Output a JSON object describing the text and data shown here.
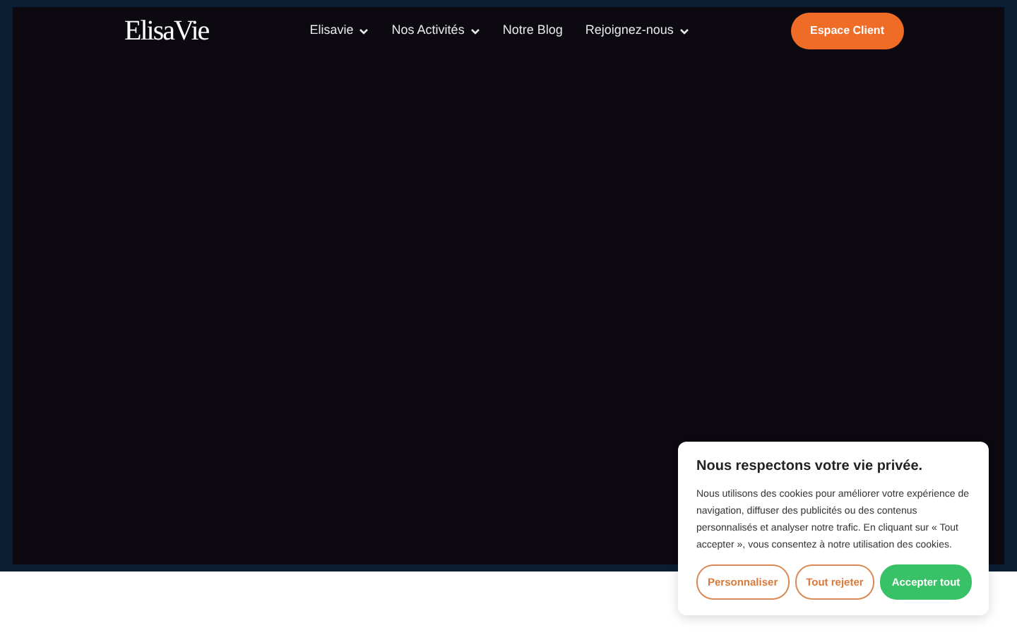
{
  "logo": "ElisaVie",
  "nav": [
    {
      "label": "Elisavie",
      "dropdown": true
    },
    {
      "label": "Nos Activités",
      "dropdown": true
    },
    {
      "label": "Notre Blog",
      "dropdown": false
    },
    {
      "label": "Rejoignez-nous",
      "dropdown": true
    }
  ],
  "cta": "Espace Client",
  "cookie": {
    "title": "Nous respectons votre vie privée.",
    "text": "Nous utilisons des cookies pour améliorer votre expérience de navigation, diffuser des publicités ou des contenus personnalisés et analyser notre trafic. En cliquant sur « Tout accepter », vous consentez à notre utilisation des cookies.",
    "buttons": [
      {
        "label": "Personnaliser",
        "kind": "outline"
      },
      {
        "label": "Tout rejeter",
        "kind": "outline"
      },
      {
        "label": "Accepter tout",
        "kind": "solid"
      }
    ]
  }
}
